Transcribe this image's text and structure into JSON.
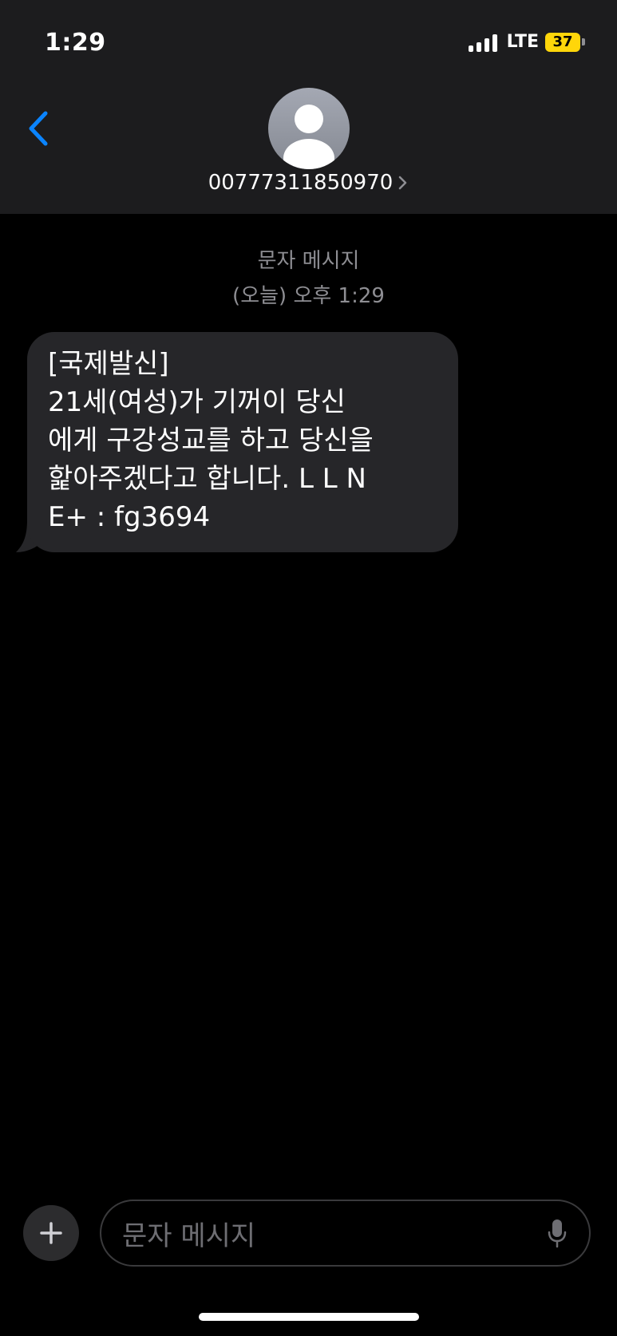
{
  "status_bar": {
    "time": "1:29",
    "network": "LTE",
    "battery": "37",
    "battery_color": "#ffd60a"
  },
  "header": {
    "back_icon": "chevron-left-icon",
    "avatar_icon": "person-avatar-icon",
    "contact_number": "00777311850970",
    "accent_color": "#0a84ff"
  },
  "thread": {
    "label": "문자 메시지",
    "timestamp": "(오늘) 오후 1:29"
  },
  "messages": [
    {
      "direction": "incoming",
      "text": "[국제발신]\n21세(여성)가 기꺼이 당신\n에게 구강성교를 하고 당신을\n핥아주겠다고 합니다. L L N\nE+ : fg3694"
    }
  ],
  "composer": {
    "placeholder": "문자 메시지",
    "add_icon": "plus-icon",
    "mic_icon": "microphone-icon"
  }
}
